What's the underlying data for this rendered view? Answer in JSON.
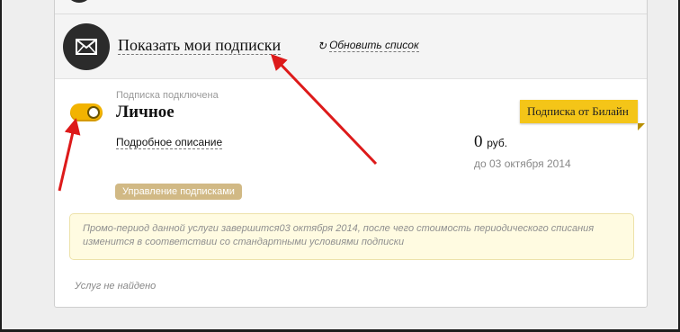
{
  "header": {
    "show_subscriptions": "Показать мои подписки",
    "refresh_list": "Обновить список",
    "refresh_glyph": "↻",
    "mail_icon": "envelope-icon"
  },
  "subscription": {
    "status": "Подписка подключена",
    "name": "Личное",
    "toggle_on": true,
    "details_link": "Подробное описание",
    "provider_badge": "Подписка от Билайн",
    "price_value": "0",
    "price_unit": "руб.",
    "valid_until": "до 03 октября 2014",
    "manage_button": "Управление подписками"
  },
  "promo_notice": "Промо-период данной услуги завершится03 октября 2014, после чего стоимость периодического списания изменится в соответствии со стандартными условиями подписки",
  "no_services": "Услуг не найдено",
  "colors": {
    "accent_yellow": "#f4c518",
    "toggle_yellow": "#f2b300",
    "manage_button": "#d1b985",
    "promo_bg": "#fffbe1",
    "annotation_arrow": "#dd1a1a"
  }
}
